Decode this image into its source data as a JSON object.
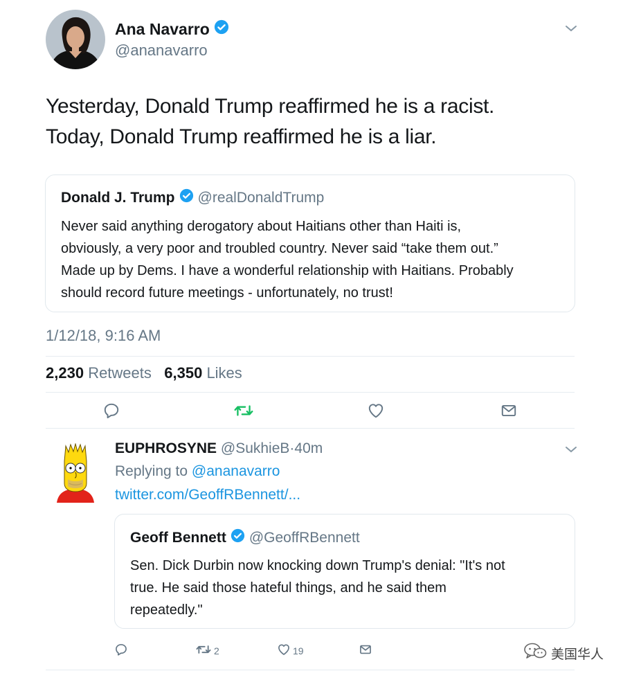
{
  "main_tweet": {
    "name": "Ana Navarro",
    "handle": "@ananavarro",
    "text_line1": "Yesterday, Donald Trump reaffirmed he is a racist.",
    "text_line2": "Today, Donald Trump reaffirmed he is a liar.",
    "quoted": {
      "name": "Donald J. Trump",
      "handle": "@realDonaldTrump",
      "lines": [
        "Never said anything derogatory about Haitians other than Haiti is,",
        "obviously, a very poor and troubled country. Never said “take them out.”",
        "Made up by Dems. I have a wonderful relationship with Haitians. Probably",
        "should record future meetings - unfortunately, no trust!"
      ]
    },
    "timestamp": "1/12/18, 9:16 AM",
    "retweets_count": "2,230",
    "retweets_label": "Retweets",
    "likes_count": "6,350",
    "likes_label": "Likes"
  },
  "reply": {
    "name": "EUPHROSYNE",
    "handle": "@SukhieB",
    "separator": "·",
    "time": "40m",
    "replying_prefix": "Replying to",
    "replying_to": "@ananavarro",
    "link": "twitter.com/GeoffRBennett/...",
    "quoted": {
      "name": "Geoff Bennett",
      "handle": "@GeoffRBennett",
      "lines": [
        "Sen. Dick Durbin now knocking down Trump's denial: \"It's not",
        "true. He said those hateful things, and he said them",
        "repeatedly.\""
      ]
    },
    "retweet_count": "2",
    "like_count": "19"
  },
  "watermark": "美国华人",
  "colors": {
    "verified": "#1da1f2",
    "link": "#1b95e0",
    "retweet_active": "#17bf63",
    "muted": "#657786"
  },
  "icons": [
    "chevron-down-icon",
    "verified-badge-icon",
    "reply-icon",
    "retweet-icon",
    "like-icon",
    "message-icon",
    "wechat-icon"
  ]
}
